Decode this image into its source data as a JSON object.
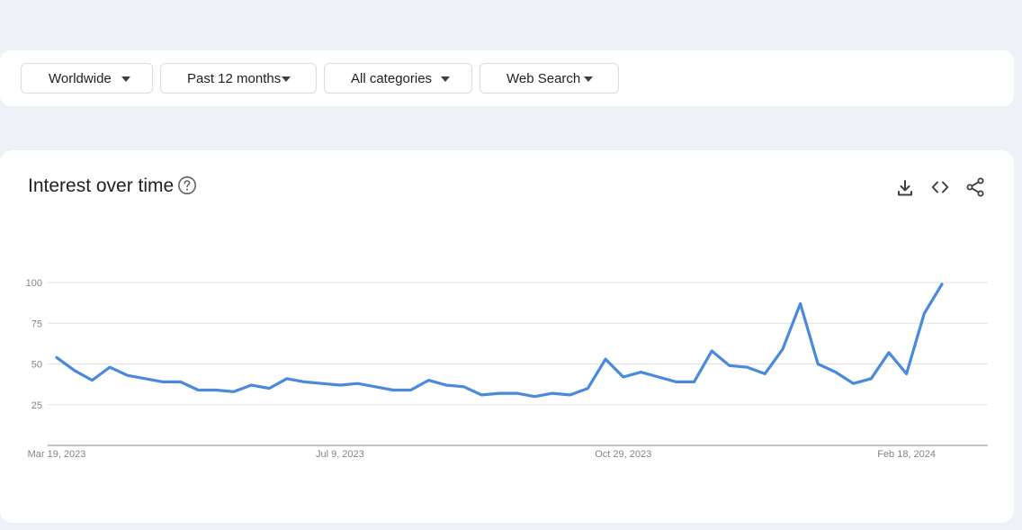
{
  "filters": {
    "region": "Worldwide",
    "time": "Past 12 months",
    "category": "All categories",
    "search_type": "Web Search"
  },
  "card": {
    "title": "Interest over time"
  },
  "icons": {
    "help": "help-circle-icon",
    "download": "download-icon",
    "embed": "code-embed-icon",
    "share": "share-icon"
  },
  "colors": {
    "line": "#4a89dc",
    "grid": "#e3e3e3",
    "axis": "#9aa0a6"
  },
  "chart_data": {
    "type": "line",
    "title": "Interest over time",
    "xlabel": "",
    "ylabel": "",
    "ylim": [
      0,
      100
    ],
    "yticks": [
      25,
      50,
      75,
      100
    ],
    "grid": true,
    "x_tick_labels": [
      "Mar 19, 2023",
      "Jul 9, 2023",
      "Oct 29, 2023",
      "Feb 18, 2024"
    ],
    "x_tick_indices": [
      0,
      16,
      32,
      48
    ],
    "series": [
      {
        "values": [
          54,
          46,
          40,
          48,
          43,
          41,
          39,
          39,
          34,
          34,
          33,
          37,
          35,
          41,
          39,
          38,
          37,
          38,
          36,
          34,
          34,
          40,
          37,
          36,
          31,
          32,
          32,
          30,
          32,
          31,
          35,
          53,
          42,
          45,
          42,
          39,
          39,
          58,
          49,
          48,
          44,
          59,
          87,
          50,
          45,
          38,
          41,
          57,
          44,
          81,
          99
        ]
      }
    ]
  }
}
